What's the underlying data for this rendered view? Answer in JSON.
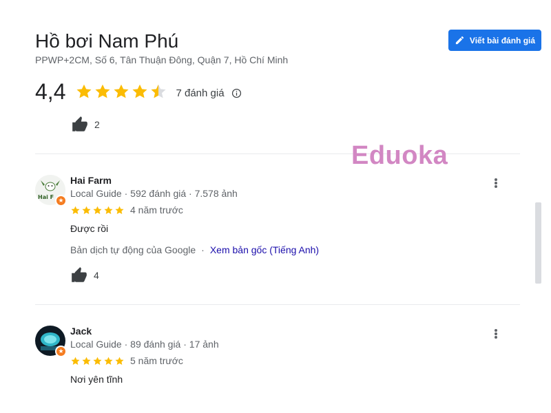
{
  "place": {
    "title": "Hồ bơi Nam Phú",
    "address": "PPWP+2CM, Số 6, Tân Thuận Đông, Quận 7, Hồ Chí Minh"
  },
  "write_review": {
    "label": "Viết bài đánh giá",
    "icon": "pencil-icon"
  },
  "rating": {
    "value": "4,4",
    "stars_filled": 4.4,
    "review_count": "7 đánh giá",
    "info_icon": "info-icon"
  },
  "summary_likes": {
    "count": "2",
    "icon": "thumbs-up-icon"
  },
  "watermark": {
    "text": "Eduoka"
  },
  "reviews": [
    {
      "name": "Hai Farm",
      "meta": "Local Guide · 592 đánh giá · 7.578 ảnh",
      "stars": 5,
      "time": "4 năm trước",
      "text": "Được rồi",
      "translation_note": "Bản dịch tự động của Google",
      "separator": "·",
      "view_original": "Xem bản gốc (Tiếng Anh)",
      "likes": "4",
      "avatar_text": "Hai F"
    },
    {
      "name": "Jack",
      "meta": "Local Guide · 89 đánh giá · 17 ảnh",
      "stars": 5,
      "time": "5 năm trước",
      "text": "Nơi yên tĩnh"
    }
  ],
  "colors": {
    "accent": "#1a73e8",
    "star": "#fbbc04",
    "star_empty": "#dadce0",
    "link": "#1a0dab",
    "guide_badge": "#f57c20",
    "watermark": "#d287c3"
  }
}
